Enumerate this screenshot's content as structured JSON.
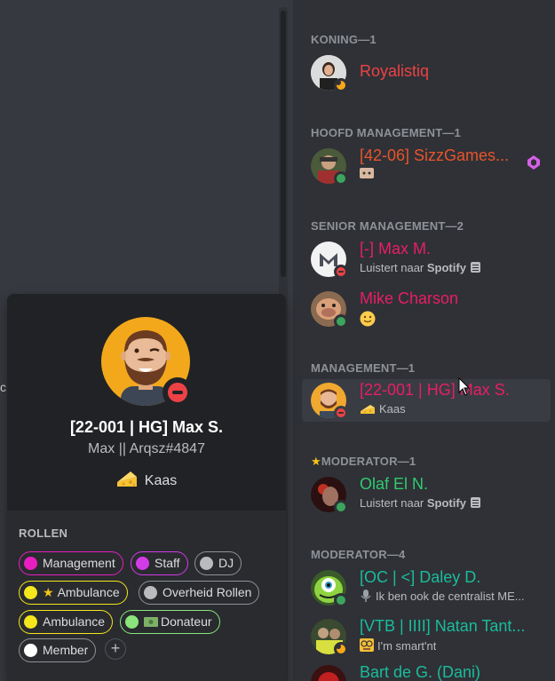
{
  "chat": {
    "stray_char": "c"
  },
  "groups": [
    {
      "label": "KONING—1"
    },
    {
      "label": "HOOFD MANAGEMENT—1"
    },
    {
      "label": "SENIOR MANAGEMENT—2"
    },
    {
      "label": "MANAGEMENT—1"
    },
    {
      "label": "MODERATOR—1"
    },
    {
      "label": "MODERATOR—4"
    }
  ],
  "members": [
    {
      "name": "Royalistiq",
      "color": "#ed4245",
      "status": "idle",
      "sub": ""
    },
    {
      "name": "[42-06] SizzGames...",
      "color": "#e8542b",
      "status": "online",
      "sub": ""
    },
    {
      "name": "[-] Max M.",
      "color": "#e91e63",
      "status": "dnd",
      "sub_prefix": "Luistert naar ",
      "sub_bold": "Spotify"
    },
    {
      "name": "Mike Charson",
      "color": "#e91e63",
      "status": "online",
      "sub": ""
    },
    {
      "name": "[22-001 | HG] Max S.",
      "color": "#e91e63",
      "status": "dnd",
      "sub": "Kaas"
    },
    {
      "name": "Olaf El N.",
      "color": "#2ecc71",
      "status": "online",
      "sub_prefix": "Luistert naar ",
      "sub_bold": "Spotify"
    },
    {
      "name": "[OC | <] Daley D.",
      "color": "#1abc9c",
      "status": "online",
      "sub": "Ik ben ook de centralist ME..."
    },
    {
      "name": "[VTB | IIII] Natan Tant...",
      "color": "#1abc9c",
      "status": "idle",
      "sub": "I'm smart'nt"
    },
    {
      "name": "Bart de G. (Dani)",
      "color": "#1abc9c",
      "status": "online",
      "sub": ""
    }
  ],
  "popout": {
    "name": "[22-001 | HG] Max S.",
    "tag": "Max || Arqsz#4847",
    "activity": "Kaas",
    "roles_title": "ROLLEN",
    "roles": [
      {
        "label": "Management",
        "color": "#e91ec0"
      },
      {
        "label": "Staff",
        "color": "#d43be8"
      },
      {
        "label": "DJ",
        "color": "#b9bbbe"
      },
      {
        "label": "Ambulance",
        "color": "#f5e71c",
        "star": "★"
      },
      {
        "label": "Overheid Rollen",
        "color": "#b9bbbe"
      },
      {
        "label": "Ambulance",
        "color": "#f5e71c"
      },
      {
        "label": "Donateur",
        "color": "#8be57a",
        "money": "💵"
      },
      {
        "label": "Member",
        "color": "#ffffff"
      }
    ],
    "add_role": "+"
  },
  "colors": {
    "accent_dnd": "#ed4245",
    "online": "#3ba55d",
    "idle": "#faa81a"
  }
}
